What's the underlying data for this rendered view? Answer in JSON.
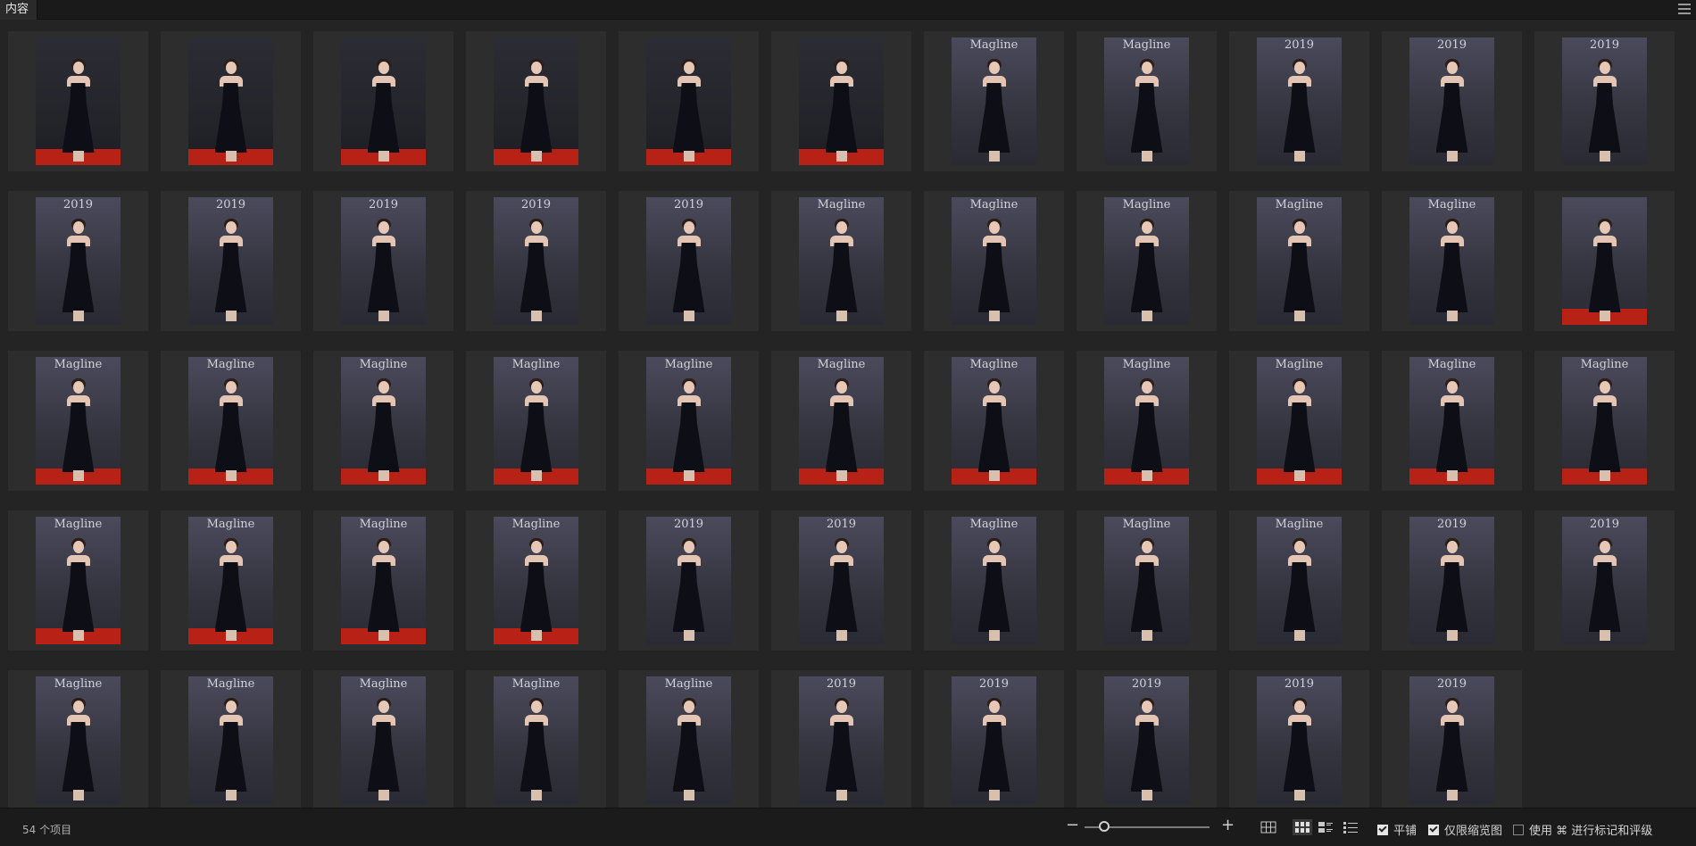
{
  "header": {
    "tab_label": "内容",
    "menu_icon": "hamburger-menu-icon"
  },
  "grid": {
    "item_count": 54,
    "thumbnails": [
      {
        "dark": true,
        "wall": "",
        "carpet": true
      },
      {
        "dark": true,
        "wall": "",
        "carpet": true
      },
      {
        "dark": true,
        "wall": "",
        "carpet": true
      },
      {
        "dark": true,
        "wall": "",
        "carpet": true
      },
      {
        "dark": true,
        "wall": "",
        "carpet": true
      },
      {
        "dark": true,
        "wall": "",
        "carpet": true
      },
      {
        "dark": false,
        "wall": "Magline",
        "carpet": false
      },
      {
        "dark": false,
        "wall": "Magline",
        "carpet": false
      },
      {
        "dark": false,
        "wall": "2019",
        "carpet": false
      },
      {
        "dark": false,
        "wall": "2019",
        "carpet": false
      },
      {
        "dark": false,
        "wall": "2019",
        "carpet": false
      },
      {
        "dark": false,
        "wall": "2019",
        "carpet": false
      },
      {
        "dark": false,
        "wall": "2019",
        "carpet": false
      },
      {
        "dark": false,
        "wall": "2019",
        "carpet": false
      },
      {
        "dark": false,
        "wall": "2019",
        "carpet": false
      },
      {
        "dark": false,
        "wall": "2019",
        "carpet": false
      },
      {
        "dark": false,
        "wall": "Magline",
        "carpet": false
      },
      {
        "dark": false,
        "wall": "Magline",
        "carpet": false
      },
      {
        "dark": false,
        "wall": "Magline",
        "carpet": false
      },
      {
        "dark": false,
        "wall": "Magline",
        "carpet": false
      },
      {
        "dark": false,
        "wall": "Magline",
        "carpet": false
      },
      {
        "dark": false,
        "wall": "",
        "carpet": true
      },
      {
        "dark": false,
        "wall": "Magline",
        "carpet": true
      },
      {
        "dark": false,
        "wall": "Magline",
        "carpet": true
      },
      {
        "dark": false,
        "wall": "Magline",
        "carpet": true
      },
      {
        "dark": false,
        "wall": "Magline",
        "carpet": true
      },
      {
        "dark": false,
        "wall": "Magline",
        "carpet": true
      },
      {
        "dark": false,
        "wall": "Magline",
        "carpet": true
      },
      {
        "dark": false,
        "wall": "Magline",
        "carpet": true
      },
      {
        "dark": false,
        "wall": "Magline",
        "carpet": true
      },
      {
        "dark": false,
        "wall": "Magline",
        "carpet": true
      },
      {
        "dark": false,
        "wall": "Magline",
        "carpet": true
      },
      {
        "dark": false,
        "wall": "Magline",
        "carpet": true
      },
      {
        "dark": false,
        "wall": "Magline",
        "carpet": true
      },
      {
        "dark": false,
        "wall": "Magline",
        "carpet": true
      },
      {
        "dark": false,
        "wall": "Magline",
        "carpet": true
      },
      {
        "dark": false,
        "wall": "Magline",
        "carpet": true
      },
      {
        "dark": false,
        "wall": "2019",
        "carpet": false
      },
      {
        "dark": false,
        "wall": "2019",
        "carpet": false
      },
      {
        "dark": false,
        "wall": "Magline",
        "carpet": false
      },
      {
        "dark": false,
        "wall": "Magline",
        "carpet": false
      },
      {
        "dark": false,
        "wall": "Magline",
        "carpet": false
      },
      {
        "dark": false,
        "wall": "2019",
        "carpet": false
      },
      {
        "dark": false,
        "wall": "2019",
        "carpet": false
      },
      {
        "dark": false,
        "wall": "Magline",
        "carpet": false
      },
      {
        "dark": false,
        "wall": "Magline",
        "carpet": false
      },
      {
        "dark": false,
        "wall": "Magline",
        "carpet": false
      },
      {
        "dark": false,
        "wall": "Magline",
        "carpet": false
      },
      {
        "dark": false,
        "wall": "Magline",
        "carpet": false
      },
      {
        "dark": false,
        "wall": "2019",
        "carpet": false
      },
      {
        "dark": false,
        "wall": "2019",
        "carpet": false
      },
      {
        "dark": false,
        "wall": "2019",
        "carpet": false
      },
      {
        "dark": false,
        "wall": "2019",
        "carpet": false
      },
      {
        "dark": false,
        "wall": "2019",
        "carpet": false
      }
    ]
  },
  "status": {
    "count_label": "54 个项目",
    "zoom_minus": "−",
    "zoom_plus": "+",
    "zoom_level_fraction": 0.16,
    "checkbox_tile_label": "平铺",
    "checkbox_tile_checked": true,
    "checkbox_thumb_only_label": "仅限缩览图",
    "checkbox_thumb_only_checked": true,
    "checkbox_rating_label": "使用 ⌘ 进行标记和评级",
    "checkbox_rating_checked": false
  },
  "colors": {
    "background": "#242424",
    "cell": "#2d2d2d",
    "carpet": "#b82116",
    "dress": "#0e0f16"
  }
}
